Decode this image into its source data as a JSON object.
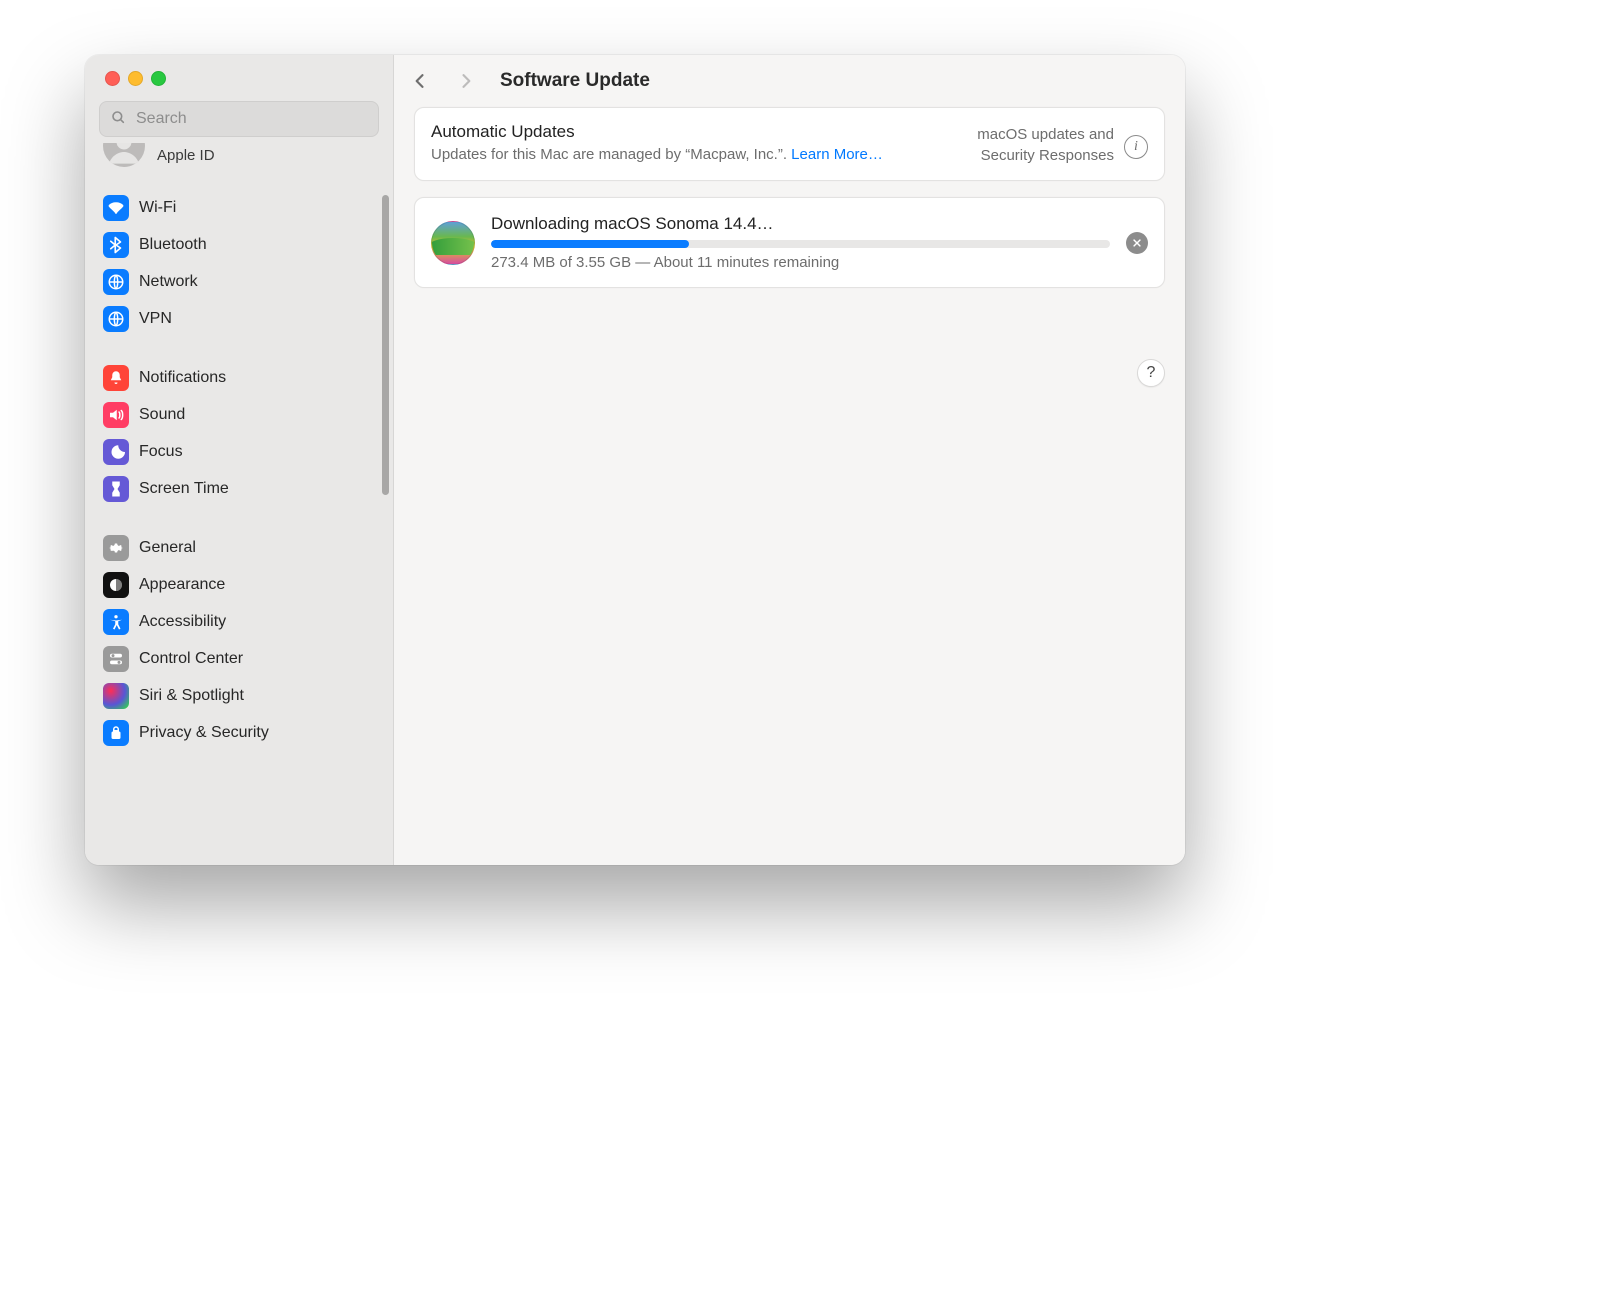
{
  "window": {
    "page_title": "Software Update"
  },
  "search": {
    "placeholder": "Search"
  },
  "apple_id": {
    "label": "Apple ID"
  },
  "sidebar": {
    "groups": [
      {
        "items": [
          {
            "id": "wifi",
            "label": "Wi-Fi",
            "color": "#0a7cff"
          },
          {
            "id": "bluetooth",
            "label": "Bluetooth",
            "color": "#0a7cff"
          },
          {
            "id": "network",
            "label": "Network",
            "color": "#0a7cff"
          },
          {
            "id": "vpn",
            "label": "VPN",
            "color": "#0a7cff"
          }
        ]
      },
      {
        "items": [
          {
            "id": "notifications",
            "label": "Notifications",
            "color": "#ff4438"
          },
          {
            "id": "sound",
            "label": "Sound",
            "color": "#ff3d64"
          },
          {
            "id": "focus",
            "label": "Focus",
            "color": "#6559d6"
          },
          {
            "id": "screen-time",
            "label": "Screen Time",
            "color": "#6559d6"
          }
        ]
      },
      {
        "items": [
          {
            "id": "general",
            "label": "General",
            "color": "#9a9a9a"
          },
          {
            "id": "appearance",
            "label": "Appearance",
            "color": "#111111"
          },
          {
            "id": "accessibility",
            "label": "Accessibility",
            "color": "#0a7cff"
          },
          {
            "id": "control-center",
            "label": "Control Center",
            "color": "#9a9a9a"
          },
          {
            "id": "siri-spotlight",
            "label": "Siri & Spotlight",
            "color": "siri"
          },
          {
            "id": "privacy-security",
            "label": "Privacy & Security",
            "color": "#0a7cff"
          }
        ]
      }
    ]
  },
  "auto_updates": {
    "title": "Automatic Updates",
    "description_prefix": "Updates for this Mac are managed by “Macpaw, Inc.”. ",
    "learn_more": "Learn More…",
    "right_line1": "macOS updates and",
    "right_line2": "Security Responses",
    "info_glyph": "i"
  },
  "download": {
    "title": "Downloading macOS Sonoma 14.4…",
    "progress_percent": 32,
    "status": "273.4 MB of 3.55 GB — About 11 minutes remaining"
  },
  "help_glyph": "?"
}
